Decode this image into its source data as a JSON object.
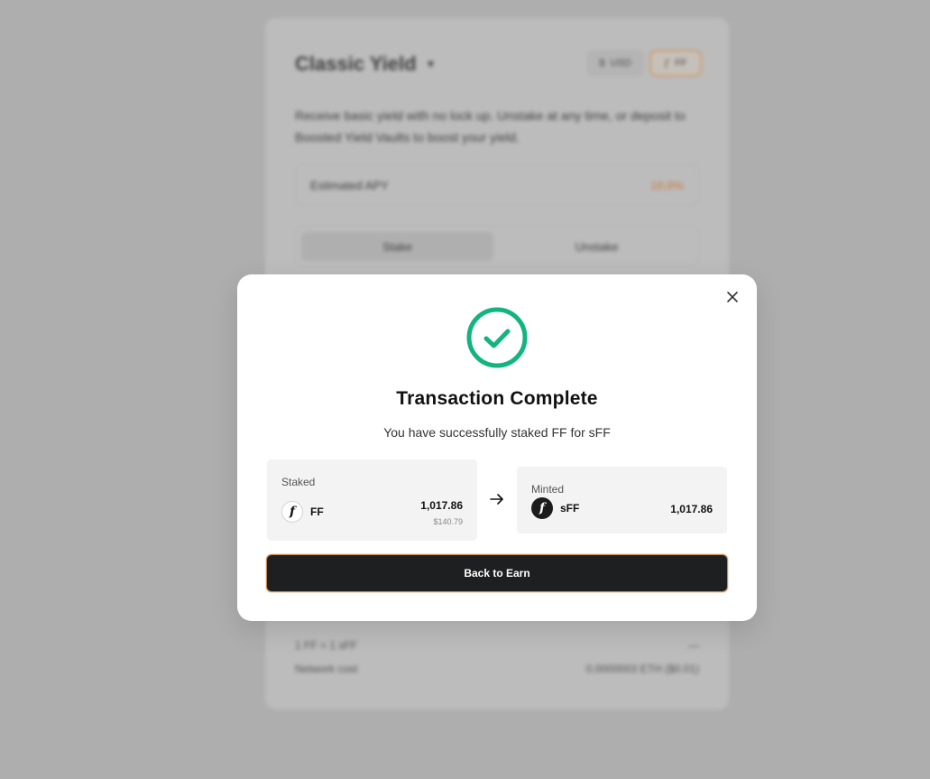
{
  "background": {
    "title": "Classic Yield",
    "toggle": {
      "usd_label": "USD",
      "ff_label": "FF"
    },
    "description": "Receive basic yield with no lock up. Unstake at any time, or deposit to Boosted Yield Vaults to boost your yield.",
    "apy": {
      "label": "Estimated APY",
      "value": "10.0%"
    },
    "tabs": [
      {
        "label": "Stake"
      },
      {
        "label": "Unstake"
      }
    ],
    "rows": [
      {
        "label": "1 FF = 1 sFF",
        "value": "—"
      },
      {
        "label": "Network cost",
        "value": "0.0000003 ETH ($0.01)"
      }
    ]
  },
  "modal": {
    "title": "Transaction Complete",
    "subtitle": "You have successfully staked FF for sFF",
    "staked": {
      "label": "Staked",
      "symbol": "FF",
      "amount": "1,017.86",
      "usd": "$140.79"
    },
    "minted": {
      "label": "Minted",
      "symbol": "sFF",
      "amount": "1,017.86"
    },
    "button_label": "Back to Earn"
  },
  "colors": {
    "success": "#12b57f",
    "accent": "#c98a57",
    "button_bg": "#1e1f21"
  },
  "icons": {
    "close": "close-icon",
    "success": "check-circle-icon",
    "arrow": "arrow-right-icon"
  }
}
